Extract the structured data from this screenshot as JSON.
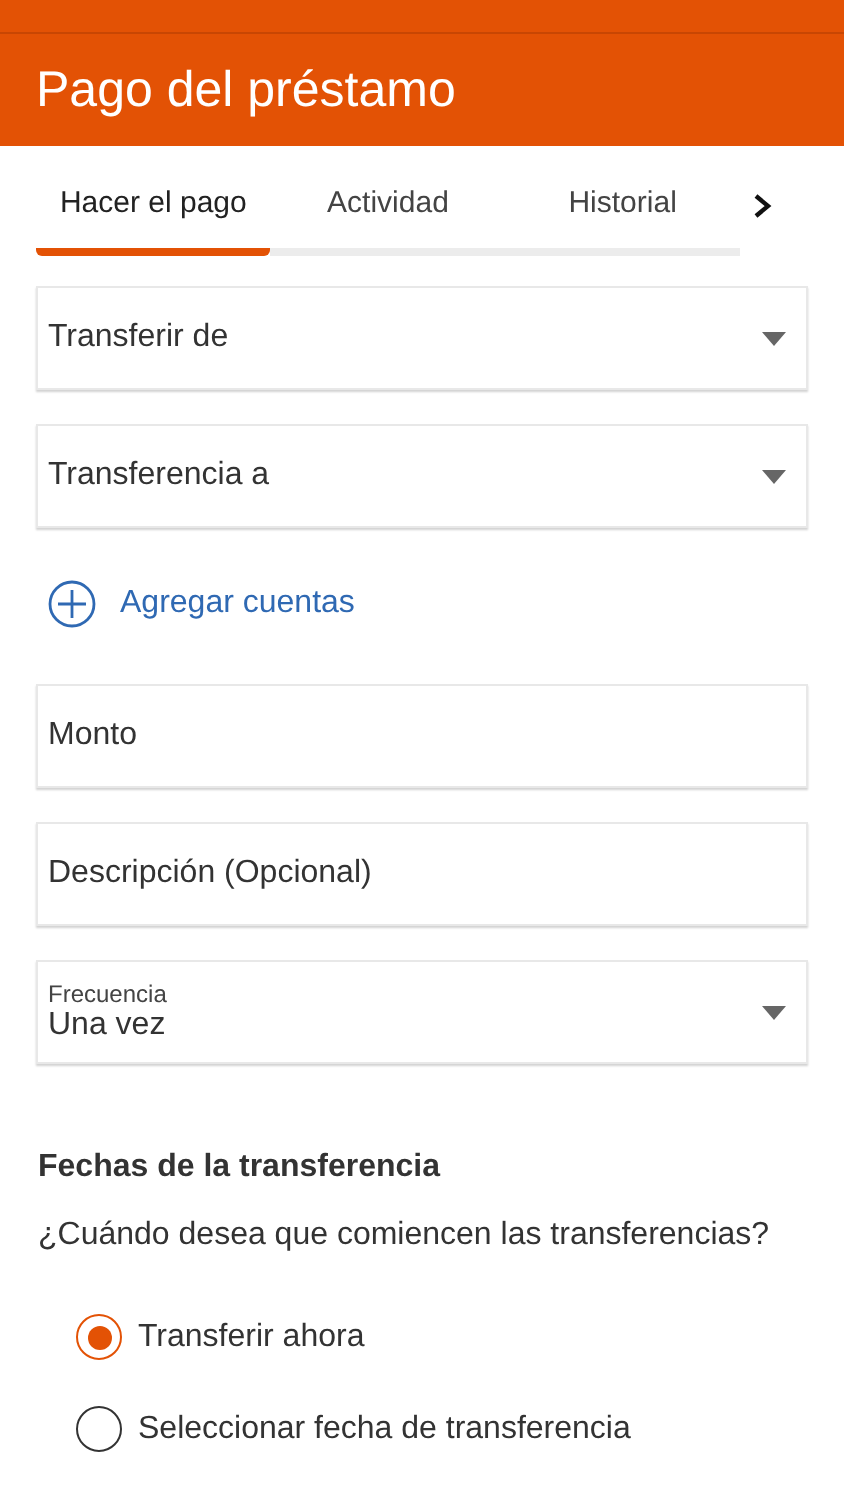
{
  "header": {
    "title": "Pago del préstamo"
  },
  "tabs": [
    {
      "label": "Hacer el pago",
      "selected": true
    },
    {
      "label": "Actividad",
      "selected": false
    },
    {
      "label": "Historial",
      "selected": false
    }
  ],
  "fields_top": [
    {
      "kind": "select",
      "placeholder": "Transferir de"
    },
    {
      "kind": "select",
      "placeholder": "Transferencia a"
    }
  ],
  "add_link": {
    "label": "Agregar cuentas"
  },
  "fields_bottom": [
    {
      "kind": "input",
      "placeholder": "Monto"
    },
    {
      "kind": "input",
      "placeholder": "Descripción (Opcional)"
    },
    {
      "kind": "select",
      "label": "Frecuencia",
      "value": "Una vez"
    }
  ],
  "dates": {
    "heading": "Fechas de la transferencia",
    "question": "¿Cuándo desea que comiencen las transferencias?",
    "options": [
      {
        "label": "Transferir ahora",
        "selected": true
      },
      {
        "label": "Seleccionar fecha de transferencia",
        "selected": false
      }
    ]
  }
}
